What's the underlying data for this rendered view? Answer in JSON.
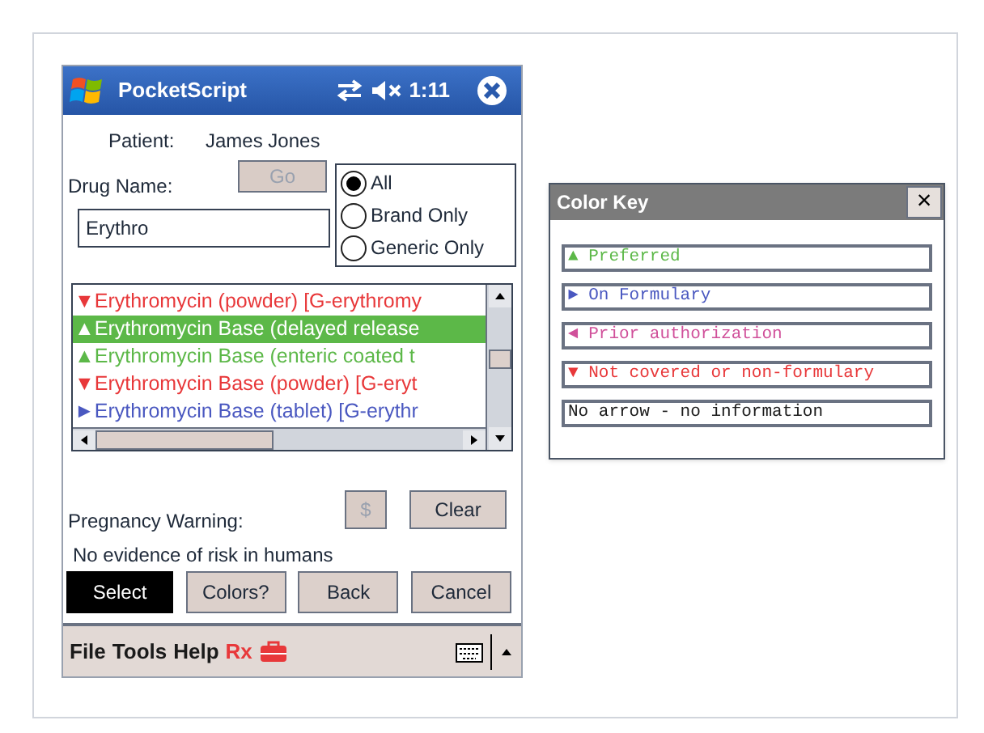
{
  "app": {
    "title": "PocketScript",
    "time": "1:11"
  },
  "patient": {
    "label": "Patient:",
    "name": "James Jones"
  },
  "drug_name": {
    "label": "Drug Name:",
    "value": "Erythro"
  },
  "go_button": {
    "label": "Go",
    "disabled": true
  },
  "filter_options": [
    {
      "label": "All",
      "selected": true
    },
    {
      "label": "Brand Only",
      "selected": false
    },
    {
      "label": "Generic Only",
      "selected": false
    }
  ],
  "results": [
    {
      "arrow": "▼",
      "text": "Erythromycin (powder) [G-erythromy",
      "color": "#e8383a",
      "selected": false
    },
    {
      "arrow": "▲",
      "text": "Erythromycin Base (delayed release",
      "color": "#5cb848",
      "selected": true
    },
    {
      "arrow": "▲",
      "text": "Erythromycin Base (enteric coated t",
      "color": "#5cb848",
      "selected": false
    },
    {
      "arrow": "▼",
      "text": "Erythromycin Base (powder) [G-eryt",
      "color": "#e8383a",
      "selected": false
    },
    {
      "arrow": "►",
      "text": "Erythromycin Base (tablet) [G-erythr",
      "color": "#4a58c0",
      "selected": false
    }
  ],
  "pregnancy_warning": {
    "label": "Pregnancy Warning:",
    "text": "No evidence of risk in humans"
  },
  "cost_button": {
    "label": "$",
    "disabled": true
  },
  "clear_button": {
    "label": "Clear",
    "disabled": false
  },
  "buttons": [
    {
      "label": "Select",
      "selected": true
    },
    {
      "label": "Colors?",
      "selected": false
    },
    {
      "label": "Back",
      "selected": false
    },
    {
      "label": "Cancel",
      "selected": false
    }
  ],
  "menu": [
    {
      "label": "File",
      "color": "#1a1a1a"
    },
    {
      "label": "Tools",
      "color": "#1a1a1a"
    },
    {
      "label": "Help",
      "color": "#1a1a1a"
    },
    {
      "label": "Rx",
      "color": "#e8383a"
    }
  ],
  "color_key": {
    "title": "Color Key",
    "close": "×",
    "items": [
      {
        "arrow": "▲",
        "text": "Preferred",
        "color": "#5cb848"
      },
      {
        "arrow": "►",
        "text": "On Formulary",
        "color": "#4a58c0"
      },
      {
        "arrow": "◄",
        "text": "Prior authorization",
        "color": "#d0509a"
      },
      {
        "arrow": "▼",
        "text": "Not covered or non-formulary",
        "color": "#e8383a"
      },
      {
        "text": "No arrow - no information",
        "color": "#1a1a1a"
      }
    ]
  }
}
